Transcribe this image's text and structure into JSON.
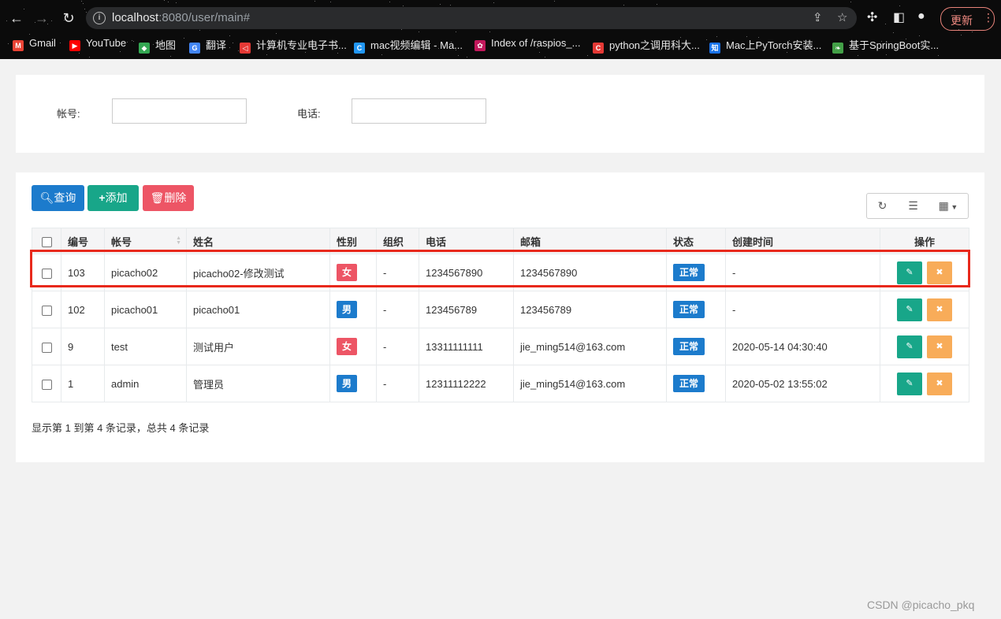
{
  "browser": {
    "url_host": "localhost",
    "url_rest": ":8080/user/main#",
    "update_label": "更新",
    "bookmarks": [
      {
        "label": "Gmail",
        "color": "#ea4335",
        "glyph": "M"
      },
      {
        "label": "YouTube",
        "color": "#ff0000",
        "glyph": "▶"
      },
      {
        "label": "地图",
        "color": "#34a853",
        "glyph": "◆"
      },
      {
        "label": "翻译",
        "color": "#4285f4",
        "glyph": "G"
      },
      {
        "label": "计算机专业电子书...",
        "color": "#e53935",
        "glyph": "◁"
      },
      {
        "label": "mac视频编辑 - Ma...",
        "color": "#2196f3",
        "glyph": "C"
      },
      {
        "label": "Index of /raspios_...",
        "color": "#c2185b",
        "glyph": "✿"
      },
      {
        "label": "python之调用科大...",
        "color": "#e53935",
        "glyph": "C"
      },
      {
        "label": "Mac上PyTorch安装...",
        "color": "#1a73e8",
        "glyph": "知"
      },
      {
        "label": "基于SpringBoot实...",
        "color": "#43a047",
        "glyph": "❧"
      }
    ]
  },
  "search": {
    "account_label": "帐号:",
    "phone_label": "电话:",
    "account_value": "",
    "phone_value": ""
  },
  "toolbar": {
    "query_label": "查询",
    "add_label": "添加",
    "delete_label": "删除"
  },
  "table": {
    "headers": [
      "编号",
      "帐号",
      "姓名",
      "性别",
      "组织",
      "电话",
      "邮箱",
      "状态",
      "创建时间",
      "操作"
    ],
    "rows": [
      {
        "id": "103",
        "account": "picacho02",
        "name": "picacho02-修改测试",
        "gender": "女",
        "org": "-",
        "phone": "1234567890",
        "email": "1234567890",
        "status": "正常",
        "created": "-"
      },
      {
        "id": "102",
        "account": "picacho01",
        "name": "picacho01",
        "gender": "男",
        "org": "-",
        "phone": "123456789",
        "email": "123456789",
        "status": "正常",
        "created": "-"
      },
      {
        "id": "9",
        "account": "test",
        "name": "测试用户",
        "gender": "女",
        "org": "-",
        "phone": "13311111111",
        "email": "jie_ming514@163.com",
        "status": "正常",
        "created": "2020-05-14 04:30:40"
      },
      {
        "id": "1",
        "account": "admin",
        "name": "管理员",
        "gender": "男",
        "org": "-",
        "phone": "12311112222",
        "email": "jie_ming514@163.com",
        "status": "正常",
        "created": "2020-05-02 13:55:02"
      }
    ]
  },
  "pagination": {
    "info": "显示第 1 到第 4 条记录，总共 4 条记录"
  },
  "watermark": "CSDN @picacho_pkq",
  "colors": {
    "primary": "#1c7bcc",
    "success": "#18a689",
    "danger": "#ed5565",
    "warning": "#f8ac59",
    "highlight": "#e8291c"
  }
}
